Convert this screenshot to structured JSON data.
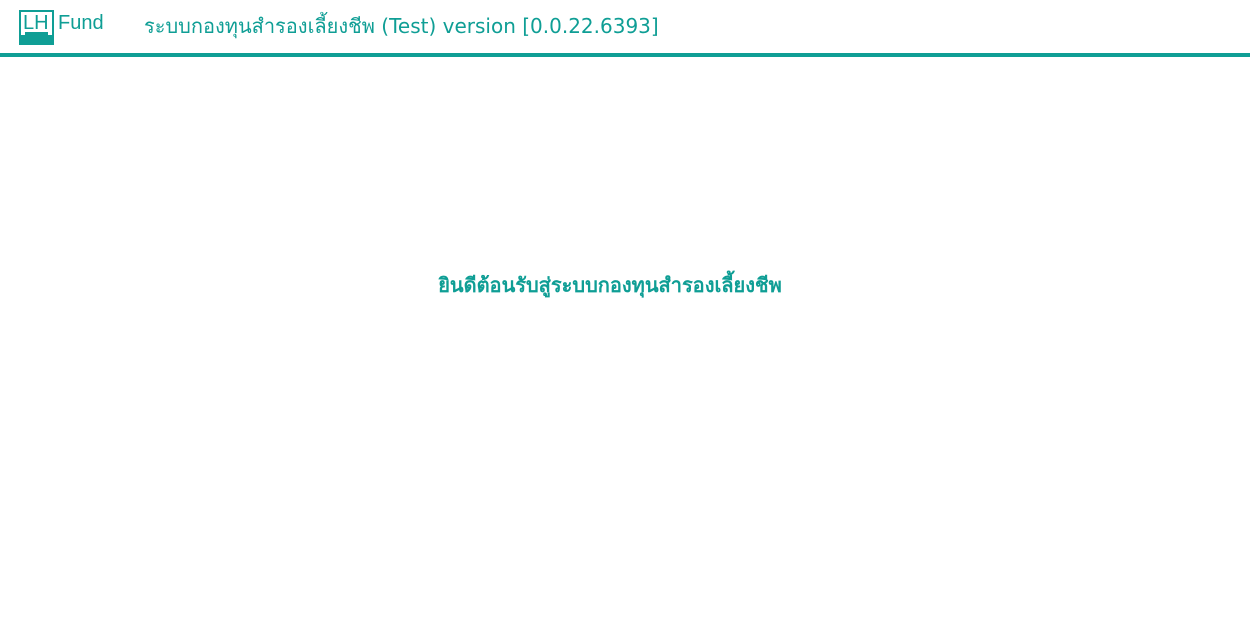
{
  "header": {
    "logo": {
      "mark_text": "LH",
      "brand_text": "Fund"
    },
    "title": "ระบบกองทุนสำรองเลี้ยงชีพ (Test) version [0.0.22.6393]"
  },
  "main": {
    "welcome_text": "ยินดีต้อนรับสู่ระบบกองทุนสำรองเลี้ยงชีพ"
  },
  "colors": {
    "accent": "#0f9e95",
    "background": "#ffffff"
  }
}
